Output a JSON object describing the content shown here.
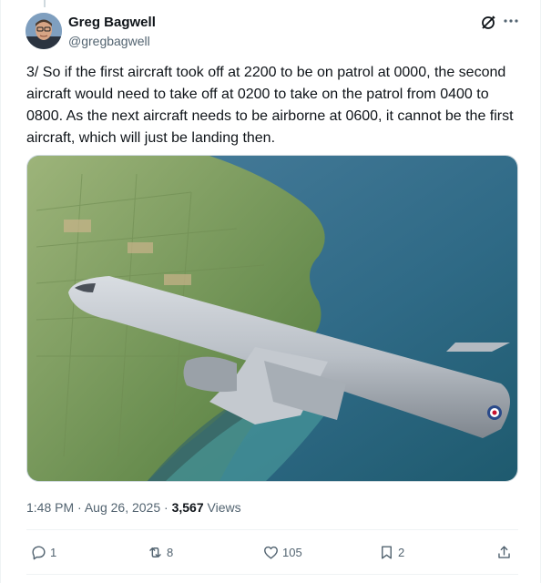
{
  "author": {
    "display_name": "Greg Bagwell",
    "handle": "@gregbagwell"
  },
  "icons": {
    "grok": "grok-icon",
    "more": "more-options-icon",
    "reply": "reply-icon",
    "repost": "repost-icon",
    "like": "like-icon",
    "bookmark": "bookmark-icon",
    "share": "share-icon"
  },
  "tweet": {
    "text": "3/ So if the first aircraft took off at 2200 to be on patrol at 0000, the second aircraft would need to take off at 0200 to take on the patrol from 0400 to 0800. As the next aircraft needs to be airborne at 0600, it cannot be the first aircraft, which will just be landing then."
  },
  "meta": {
    "time": "1:48 PM",
    "separator": "·",
    "date": "Aug 26, 2025",
    "views_count": "3,567",
    "views_label": "Views"
  },
  "actions": {
    "replies": "1",
    "reposts": "8",
    "likes": "105",
    "bookmarks": "2"
  },
  "colors": {
    "text_primary": "#0f1419",
    "text_secondary": "#536471",
    "border": "#eff3f4"
  }
}
